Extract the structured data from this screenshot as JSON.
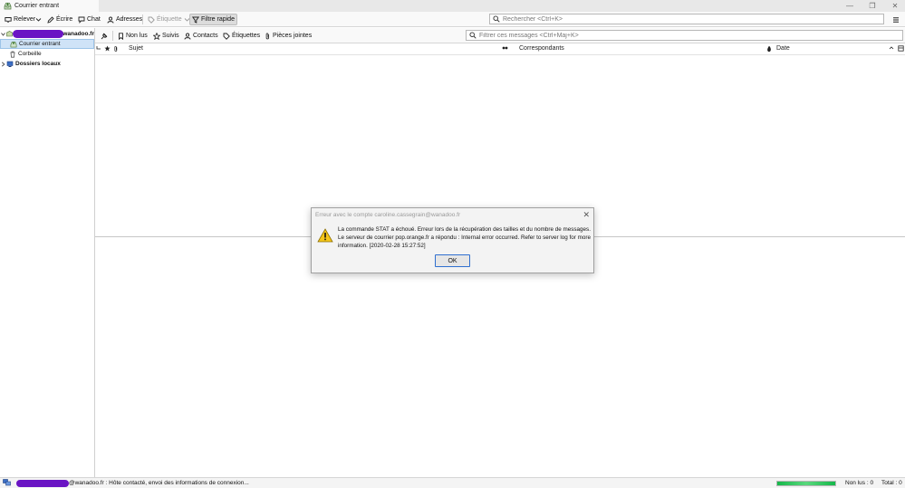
{
  "window": {
    "tab_title": "Courrier entrant"
  },
  "toolbar": {
    "get_messages": "Relever",
    "write": "Écrire",
    "chat": "Chat",
    "address_book": "Adresses",
    "tag": "Étiquette",
    "quick_filter": "Filtre rapide",
    "search_placeholder": "Rechercher <Ctrl+K>"
  },
  "folders": {
    "account_suffix": "@wanadoo.fr",
    "inbox": "Courrier entrant",
    "trash": "Corbeille",
    "local_folders": "Dossiers locaux"
  },
  "quick_filter": {
    "unread": "Non lus",
    "starred": "Suivis",
    "contacts": "Contacts",
    "tags": "Étiquettes",
    "attachments": "Pièces jointes",
    "filter_placeholder": "Filtrer ces messages <Ctrl+Maj+K>"
  },
  "columns": {
    "subject": "Sujet",
    "correspondents": "Correspondants",
    "date": "Date"
  },
  "dialog": {
    "title": "Erreur avec le compte caroline.cassegrain@wanadoo.fr",
    "message": "La commande STAT a échoué. Erreur lors de la récupération des tailles et du nombre de messages. Le serveur de courrier pop.orange.fr a répondu : Internal error occurred. Refer to server log for more information. [2020-02-28 15:27:52]",
    "ok_label": "OK"
  },
  "status": {
    "text": "@wanadoo.fr : Hôte contacté, envoi des informations de connexion...",
    "progress": 1.0,
    "unread": "Non lus : 0",
    "total": "Total : 0"
  },
  "colors": {
    "redaction": "#6a14c4",
    "selection": "#cfe3f7",
    "progress": "#15b84a",
    "dialog_button_border": "#2f6fcf"
  }
}
